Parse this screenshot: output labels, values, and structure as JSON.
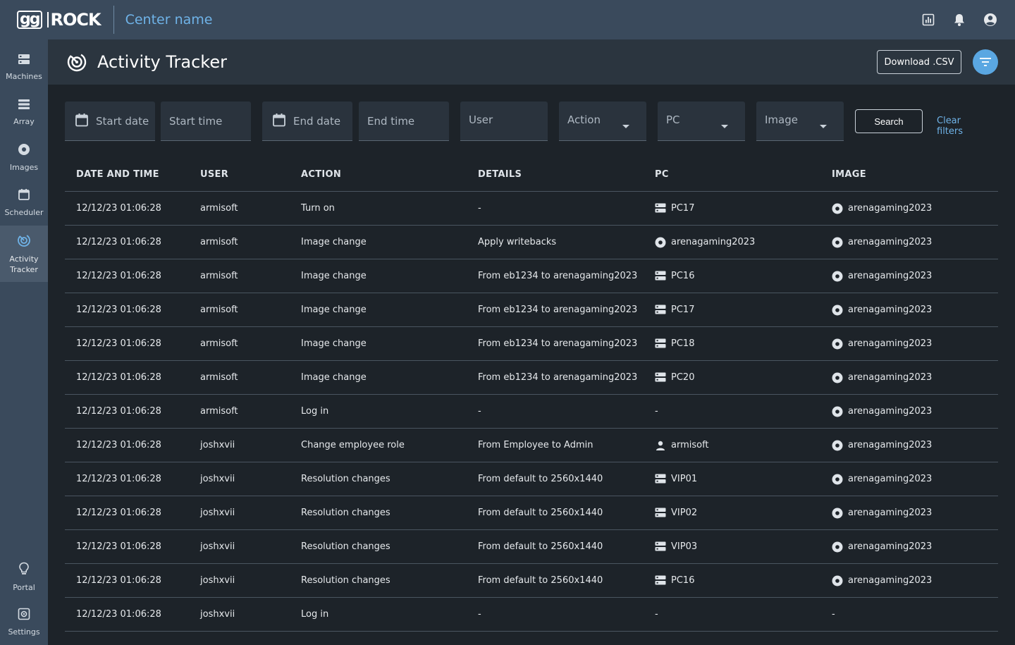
{
  "topbar": {
    "logo_gg": "gg",
    "logo_rock": "ROCK",
    "center_name": "Center name",
    "icons": [
      "report-icon",
      "bell-icon",
      "account-icon"
    ]
  },
  "sidebar": {
    "items": [
      {
        "label": "Machines",
        "icon": "server-icon"
      },
      {
        "label": "Array",
        "icon": "array-icon"
      },
      {
        "label": "Images",
        "icon": "disc-icon"
      },
      {
        "label": "Scheduler",
        "icon": "calendar-icon"
      },
      {
        "label": "Activity Tracker",
        "icon": "activity-icon",
        "active": true
      }
    ],
    "bottom": [
      {
        "label": "Portal",
        "icon": "bulb-icon"
      },
      {
        "label": "Settings",
        "icon": "gear-icon"
      }
    ]
  },
  "header": {
    "title": "Activity Tracker",
    "download_label": "Download .CSV"
  },
  "filters": {
    "start_date": "Start date",
    "start_time": "Start time",
    "end_date": "End date",
    "end_time": "End time",
    "user": "User",
    "action": "Action",
    "pc": "PC",
    "image": "Image",
    "search_label": "Search",
    "clear_label": "Clear filters"
  },
  "table": {
    "columns": [
      "DATE AND TIME",
      "USER",
      "ACTION",
      "DETAILS",
      "PC",
      "IMAGE"
    ],
    "rows": [
      {
        "date": "12/12/23 01:06:28",
        "user": "armisoft",
        "action": "Turn on",
        "details": "-",
        "details_icon": "",
        "pc": "PC17",
        "pc_icon": "server",
        "image": "arenagaming2023",
        "image_icon": "disc"
      },
      {
        "date": "12/12/23 01:06:28",
        "user": "armisoft",
        "action": "Image change",
        "details": "Apply writebacks",
        "details_icon": "",
        "pc": "arenagaming2023",
        "pc_icon": "disc",
        "image": "arenagaming2023",
        "image_icon": "disc"
      },
      {
        "date": "12/12/23 01:06:28",
        "user": "armisoft",
        "action": "Image change",
        "details": "From eb1234 to arenagaming2023",
        "details_icon": "",
        "pc": "PC16",
        "pc_icon": "server",
        "image": "arenagaming2023",
        "image_icon": "disc"
      },
      {
        "date": "12/12/23 01:06:28",
        "user": "armisoft",
        "action": "Image change",
        "details": "From eb1234 to arenagaming2023",
        "details_icon": "",
        "pc": "PC17",
        "pc_icon": "server",
        "image": "arenagaming2023",
        "image_icon": "disc"
      },
      {
        "date": "12/12/23 01:06:28",
        "user": "armisoft",
        "action": "Image change",
        "details": "From eb1234 to arenagaming2023",
        "details_icon": "",
        "pc": "PC18",
        "pc_icon": "server",
        "image": "arenagaming2023",
        "image_icon": "disc"
      },
      {
        "date": "12/12/23 01:06:28",
        "user": "armisoft",
        "action": "Image change",
        "details": "From eb1234 to arenagaming2023",
        "details_icon": "",
        "pc": "PC20",
        "pc_icon": "server",
        "image": "arenagaming2023",
        "image_icon": "disc"
      },
      {
        "date": "12/12/23 01:06:28",
        "user": "armisoft",
        "action": "Log in",
        "details": "-",
        "details_icon": "",
        "pc": "-",
        "pc_icon": "",
        "image": "arenagaming2023",
        "image_icon": "disc"
      },
      {
        "date": "12/12/23 01:06:28",
        "user": "joshxvii",
        "action": "Change employee role",
        "details": "From Employee to Admin",
        "details_icon": "",
        "pc": "armisoft",
        "pc_icon": "user",
        "image": "arenagaming2023",
        "image_icon": "disc"
      },
      {
        "date": "12/12/23 01:06:28",
        "user": "joshxvii",
        "action": "Resolution changes",
        "details": "From default to 2560x1440",
        "details_icon": "",
        "pc": "VIP01",
        "pc_icon": "server",
        "image": "arenagaming2023",
        "image_icon": "disc"
      },
      {
        "date": "12/12/23 01:06:28",
        "user": "joshxvii",
        "action": "Resolution changes",
        "details": "From default to 2560x1440",
        "details_icon": "",
        "pc": "VIP02",
        "pc_icon": "server",
        "image": "arenagaming2023",
        "image_icon": "disc"
      },
      {
        "date": "12/12/23 01:06:28",
        "user": "joshxvii",
        "action": "Resolution changes",
        "details": "From default to 2560x1440",
        "details_icon": "",
        "pc": "VIP03",
        "pc_icon": "server",
        "image": "arenagaming2023",
        "image_icon": "disc"
      },
      {
        "date": "12/12/23 01:06:28",
        "user": "joshxvii",
        "action": "Resolution changes",
        "details": "From default to 2560x1440",
        "details_icon": "",
        "pc": "PC16",
        "pc_icon": "server",
        "image": "arenagaming2023",
        "image_icon": "disc"
      },
      {
        "date": "12/12/23 01:06:28",
        "user": "joshxvii",
        "action": "Log in",
        "details": "-",
        "details_icon": "",
        "pc": "-",
        "pc_icon": "",
        "image": "-",
        "image_icon": ""
      }
    ]
  },
  "colors": {
    "topbar_bg": "#3a4a5c",
    "page_bg": "#1d2329",
    "accent": "#6fb3e8",
    "filter_button": "#5aa7e2"
  }
}
